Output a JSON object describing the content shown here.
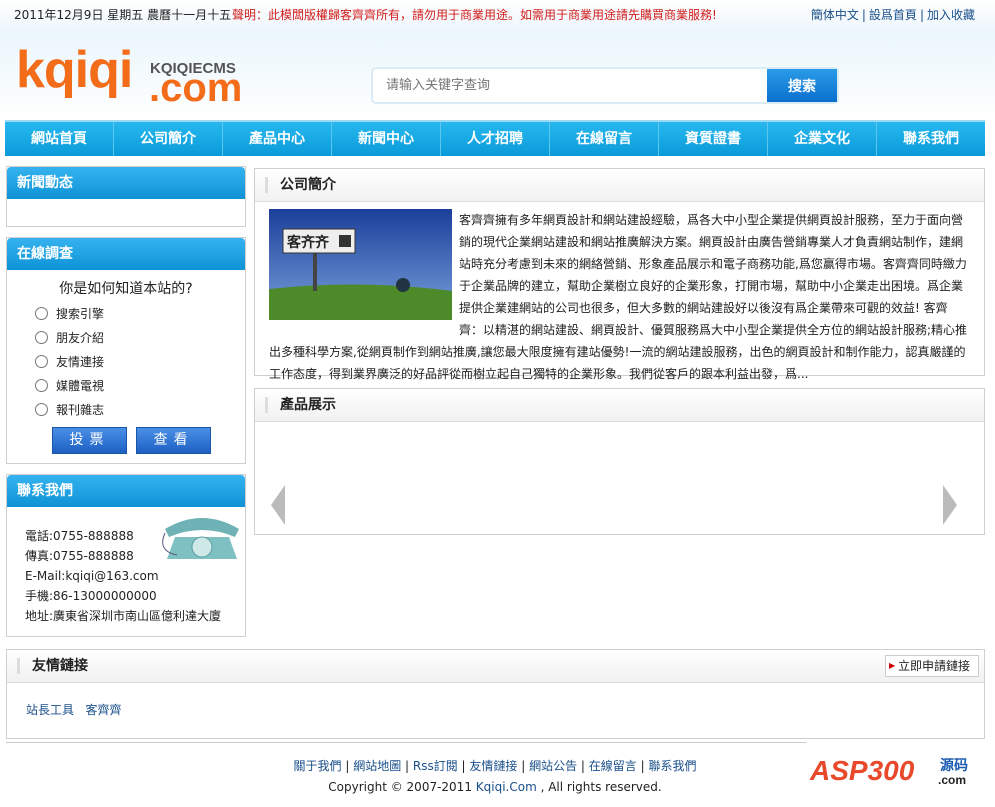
{
  "topbar": {
    "date": "2011年12月9日 星期五 農曆十一月十五",
    "notice": "聲明：此模闆版權歸客齊齊所有，請勿用于商業用途。如需用于商業用途請先購買商業服務!",
    "links": [
      "簡体中文",
      "設爲首頁",
      "加入收藏"
    ]
  },
  "logo": {
    "main": "kqiqi",
    "sub": "KQIQIECMS",
    "domain": ".com"
  },
  "search": {
    "placeholder": "请输入关键字查询",
    "button": "搜索"
  },
  "nav": [
    "網站首頁",
    "公司簡介",
    "產品中心",
    "新聞中心",
    "人才招聘",
    "在線留言",
    "資質證書",
    "企業文化",
    "聯系我們"
  ],
  "sidebar": {
    "news": {
      "title": "新聞動态"
    },
    "survey": {
      "title": "在線調查",
      "question": "你是如何知道本站的?",
      "options": [
        "搜索引擎",
        "朋友介紹",
        "友情連接",
        "媒體電視",
        "報刊雜志"
      ],
      "vote": "投票",
      "view": "查看"
    },
    "contact": {
      "title": "聯系我們",
      "lines": [
        "電話:0755-888888",
        "傳真:0755-888888",
        "E-Mail:kqiqi@163.com",
        "手機:86-13000000000",
        "地址:廣東省深圳市南山區億利達大廈"
      ]
    }
  },
  "about": {
    "title": "公司簡介",
    "sign_text": "客齐齐",
    "text": "客齊齊擁有多年網頁設計和網站建設經驗，爲各大中小型企業提供網頁設計服務，至力于面向營銷的現代企業網站建設和網站推廣解決方案。網頁設計由廣告營銷專業人才負責網站制作，建網站時充分考慮到未來的網絡營銷、形象產品展示和電子商務功能,爲您赢得市場。客齊齊同時緻力于企業品牌的建立，幫助企業樹立良好的企業形象，打開市場，幫助中小企業走出困境。爲企業提供企業建網站的公司也很多，但大多數的網站建設好以後沒有爲企業帶來可觀的效益! 客齊齊：以精湛的網站建設、網頁設計、優質服務爲大中小型企業提供全方位的網站設計服務;精心推出多種科學方案,從網頁制作到網站推廣,讓您最大限度擁有建站優勢!一流的網站建設服務，出色的網頁設計和制作能力，認真嚴謹的工作态度，得到業界廣泛的好品評從而樹立起自己獨特的企業形象。我們從客戶的跟本利益出發，爲..."
  },
  "products": {
    "title": "產品展示"
  },
  "friendlinks": {
    "title": "友情鏈接",
    "apply": "立即申請鏈接",
    "items": [
      "站長工具",
      "客齊齊"
    ]
  },
  "footer": {
    "links": [
      "關于我們",
      "網站地圖",
      "Rss訂閱",
      "友情鏈接",
      "網站公告",
      "在線留言",
      "聯系我們"
    ],
    "copyright_pre": "Copyright © 2007-2011 ",
    "copyright_site": "Kqiqi.Com",
    "copyright_post": " , All rights reserved.",
    "badge_main": "ASP300",
    "badge_sub": "源码",
    "badge_dom": ".com"
  }
}
